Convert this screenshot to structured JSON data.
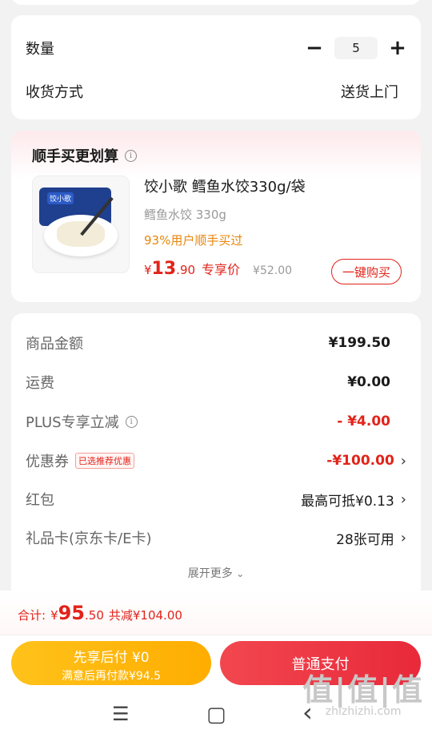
{
  "quantity": {
    "label": "数量",
    "minus": "−",
    "value": "5",
    "plus": "+"
  },
  "delivery": {
    "label": "收货方式",
    "value": "送货上门"
  },
  "addon": {
    "title": "顺手买更划算",
    "product_name": "饺小歌 鳕鱼水饺330g/袋",
    "spec": "鳕鱼水饺 330g",
    "hint": "93%用户顺手买过",
    "price_symbol": "¥",
    "price_int": "13",
    "price_dec": ".90",
    "price_tag": "专享价",
    "orig_price": "¥52.00",
    "buy_button": "一键购买",
    "img_brand": "饺小歌"
  },
  "summary": {
    "rows": [
      {
        "label": "商品金额",
        "value": "¥199.50"
      },
      {
        "label": "运费",
        "value": "¥0.00"
      },
      {
        "label": "PLUS专享立减",
        "value": "- ¥4.00"
      },
      {
        "label": "优惠券",
        "badge": "已选推荐优惠",
        "value": "-¥100.00"
      },
      {
        "label": "红包",
        "value": "最高可抵¥0.13"
      },
      {
        "label": "礼品卡(京东卡/E卡)",
        "value": "28张可用"
      }
    ],
    "expand": "展开更多"
  },
  "total": {
    "label": "合计:",
    "symbol": "¥",
    "int": "95",
    "dec": ".50",
    "saved": "共减¥104.00"
  },
  "buttons": {
    "pay_later_title": "先享后付 ¥0",
    "pay_later_sub": "满意后再付款¥94.5",
    "pay_normal": "普通支付"
  },
  "nav": {
    "menu": "☰",
    "home": "▢",
    "back": "‹"
  },
  "watermark": {
    "main": "值|值|值",
    "url": "zhizhizhi.com"
  },
  "colors": {
    "accent_red": "#e2231a",
    "orange": "#e8860a",
    "yellow_btn": "#ffb800"
  }
}
